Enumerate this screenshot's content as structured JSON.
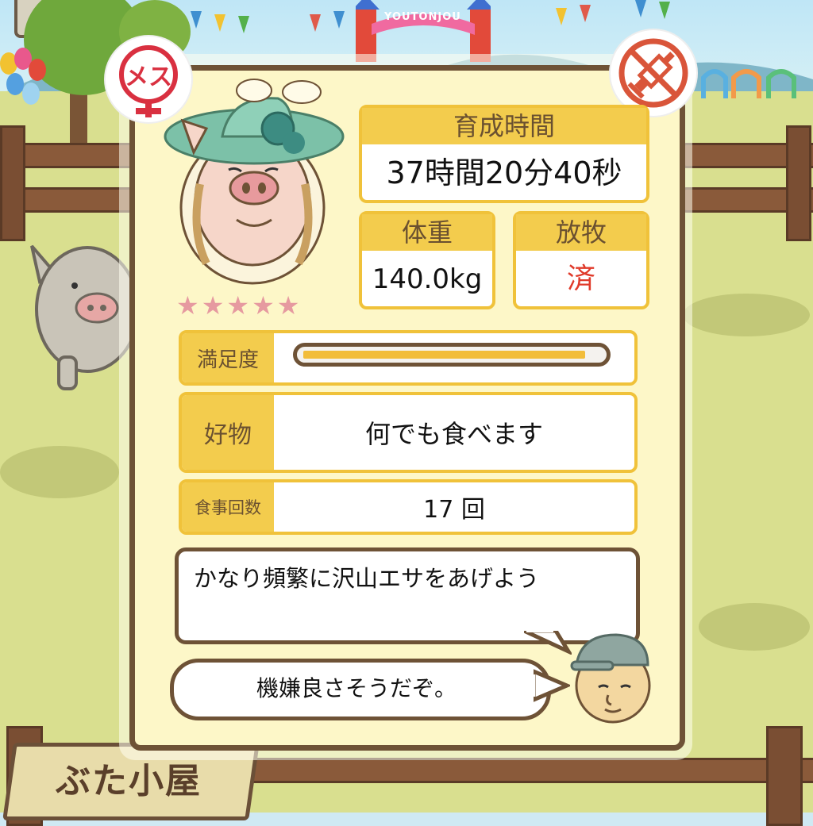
{
  "header": {
    "gate_sign": "YOUTONJOU"
  },
  "badges": {
    "gender": "メス",
    "gender_icon": "female-icon",
    "vaccine_icon": "no-syringe-icon"
  },
  "pig": {
    "stars": "★★★★★",
    "rating": 5
  },
  "stats": {
    "growth_time": {
      "label": "育成時間",
      "value": "37時間20分40秒"
    },
    "weight": {
      "label": "体重",
      "value": "140.0kg"
    },
    "grazing": {
      "label": "放牧",
      "value": "済"
    }
  },
  "satisfaction": {
    "label": "満足度",
    "level": 0.95
  },
  "favorite_food": {
    "label": "好物",
    "value": "何でも食べます"
  },
  "meal_count": {
    "label": "食事回数",
    "value": "17 回"
  },
  "advice": {
    "main": "かなり頻繁に沢山エサをあげよう",
    "comment": "機嫌良さそうだぞ。"
  },
  "footer": {
    "sign": "ぶた小屋"
  },
  "colors": {
    "accent_yellow": "#f3cc4d",
    "border_brown": "#6e5236",
    "grazing_red": "#e03a2a",
    "star_pink": "#e69aa0"
  }
}
